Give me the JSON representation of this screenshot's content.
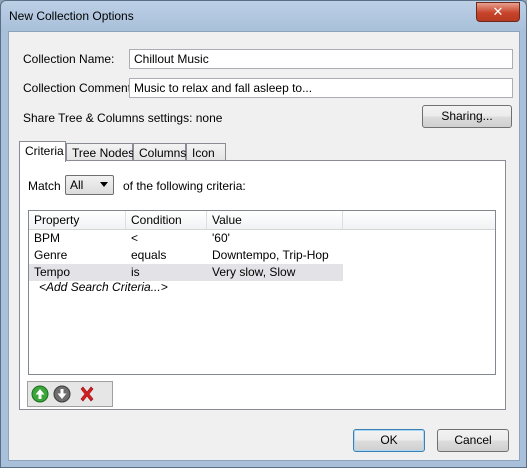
{
  "window": {
    "title": "New Collection Options",
    "close_glyph": "✕"
  },
  "form": {
    "name_label": "Collection Name:",
    "name_value": "Chillout Music",
    "comment_label": "Collection Comment:",
    "comment_value": "Music to relax and fall asleep to...",
    "share_text": "Share Tree & Columns settings: none",
    "sharing_button": "Sharing..."
  },
  "tabs": [
    {
      "label": "Criteria",
      "active": true
    },
    {
      "label": "Tree Nodes",
      "active": false
    },
    {
      "label": "Columns",
      "active": false
    },
    {
      "label": "Icon",
      "active": false
    }
  ],
  "criteria": {
    "match_label": "Match",
    "match_value": "All",
    "match_suffix": "of the following criteria:",
    "columns": [
      "Property",
      "Condition",
      "Value"
    ],
    "rows": [
      {
        "property": "BPM",
        "condition": "<",
        "value": "'60'"
      },
      {
        "property": "Genre",
        "condition": "equals",
        "value": "Downtempo, Trip-Hop"
      },
      {
        "property": "Tempo",
        "condition": "is",
        "value": "Very slow, Slow"
      }
    ],
    "selected_row": 2,
    "add_row_text": "<Add Search Criteria...>"
  },
  "toolbar_icons": [
    "move-up-icon",
    "move-down-icon",
    "delete-icon"
  ],
  "buttons": {
    "ok": "OK",
    "cancel": "Cancel"
  },
  "colors": {
    "accent": "#3c7fb1",
    "delete_red": "#d81e1e",
    "arrow_green": "#3aa53a"
  }
}
